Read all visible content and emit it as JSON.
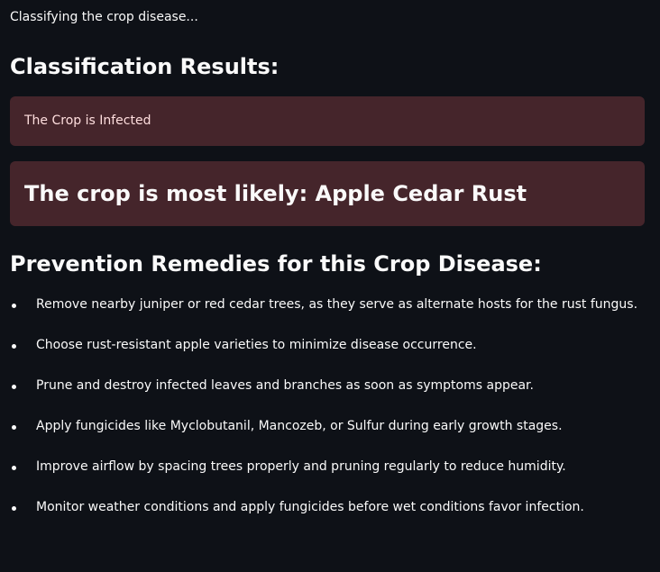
{
  "status_text": "Classifying the crop disease...",
  "results_heading": "Classification Results:",
  "infected_message": "The Crop is Infected",
  "prediction_message": "The crop is most likely: Apple Cedar Rust",
  "remedies_heading": "Prevention Remedies for this Crop Disease:",
  "remedies": [
    "Remove nearby juniper or red cedar trees, as they serve as alternate hosts for the rust fungus.",
    "Choose rust-resistant apple varieties to minimize disease occurrence.",
    "Prune and destroy infected leaves and branches as soon as symptoms appear.",
    "Apply fungicides like Myclobutanil, Mancozeb, or Sulfur during early growth stages.",
    "Improve airflow by spacing trees properly and pruning regularly to reduce humidity.",
    "Monitor weather conditions and apply fungicides before wet conditions favor infection."
  ],
  "colors": {
    "background": "#0e1117",
    "alert_background": "#45252b",
    "alert_text": "#ffdede",
    "text": "#fafafa"
  }
}
